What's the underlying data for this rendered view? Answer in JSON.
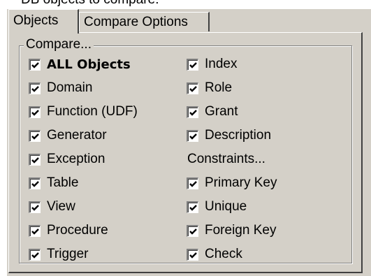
{
  "header_text": "DB objects to compare:",
  "tabs": [
    {
      "label": "Objects",
      "active": true
    },
    {
      "label": "Compare Options",
      "active": false
    }
  ],
  "group": {
    "caption": "Compare..."
  },
  "checkboxes": [
    {
      "label": "ALL Objects",
      "checked": true
    },
    {
      "label": "Domain",
      "checked": true
    },
    {
      "label": "Function (UDF)",
      "checked": true
    },
    {
      "label": "Generator",
      "checked": true
    },
    {
      "label": "Exception",
      "checked": true
    },
    {
      "label": "Table",
      "checked": true
    },
    {
      "label": "View",
      "checked": true
    },
    {
      "label": "Procedure",
      "checked": true
    },
    {
      "label": "Trigger",
      "checked": true
    },
    {
      "label": "Index",
      "checked": true
    },
    {
      "label": "Role",
      "checked": true
    },
    {
      "label": "Grant",
      "checked": true
    },
    {
      "label": "Description",
      "checked": true
    },
    {
      "label": "Primary Key",
      "checked": true
    },
    {
      "label": "Unique",
      "checked": true
    },
    {
      "label": "Foreign Key",
      "checked": true
    },
    {
      "label": "Check",
      "checked": true
    }
  ],
  "constraints_label": "Constraints...",
  "colors": {
    "face": "#d4d0c8",
    "shadow": "#808080",
    "highlight": "#ffffff"
  }
}
